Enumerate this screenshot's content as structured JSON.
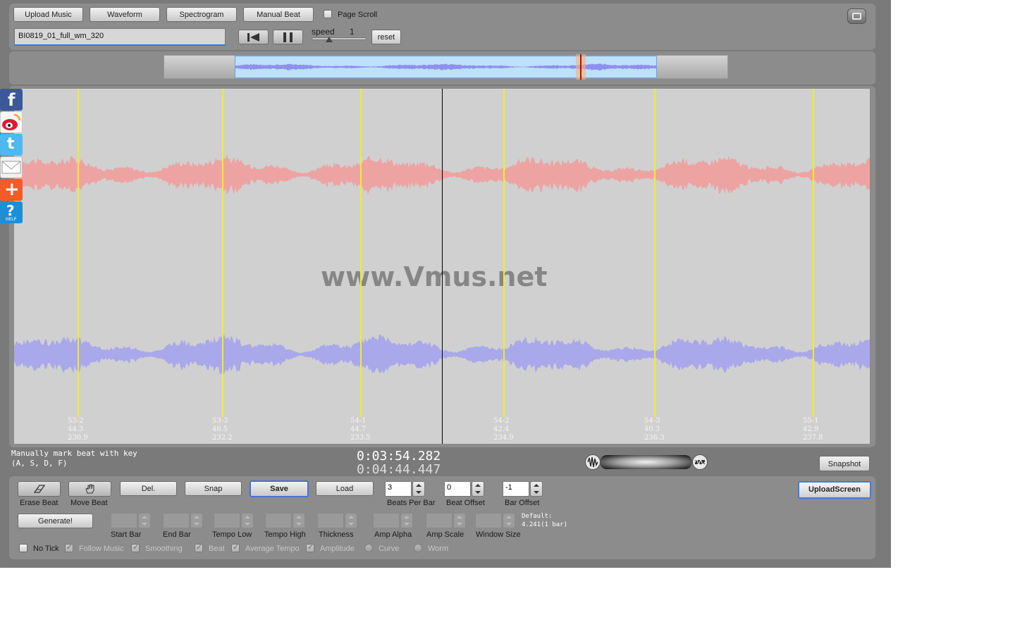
{
  "toolbar": {
    "upload_music": "Upload Music",
    "waveform": "Waveform",
    "spectrogram": "Spectrogram",
    "manual_beat": "Manual Beat",
    "page_scroll": "Page Scroll",
    "file_name": "BI0819_01_full_wm_320",
    "speed_label": "speed",
    "speed_value": "1",
    "reset": "reset"
  },
  "overview": {
    "viewport_start_fraction": 0.125,
    "viewport_end_fraction": 0.875,
    "playhead_fraction": 0.74
  },
  "main_view": {
    "watermark": "www.Vmus.net",
    "beats": [
      {
        "label": "53-2",
        "v1": "44.3",
        "v2": "230.9"
      },
      {
        "label": "53-3",
        "v1": "46.5",
        "v2": "232.2"
      },
      {
        "label": "54-1",
        "v1": "44.7",
        "v2": "233.5"
      },
      {
        "label": "54-2",
        "v1": "42.4",
        "v2": "234.9"
      },
      {
        "label": "54-3",
        "v1": "40.3",
        "v2": "236.3"
      },
      {
        "label": "55-1",
        "v1": "42.9",
        "v2": "237.8"
      }
    ]
  },
  "status": {
    "hint_line1": "Manually mark beat with key",
    "hint_line2": "(A, S, D, F)",
    "current_time": "0:03:54.282",
    "total_time": "0:04:44.447",
    "snapshot": "Snapshot"
  },
  "controls": {
    "erase_beat": "Erase Beat",
    "move_beat": "Move Beat",
    "del": "Del.",
    "snap": "Snap",
    "save": "Save",
    "load": "Load",
    "beats_per_bar_label": "Beats Per Bar",
    "beats_per_bar_value": "3",
    "beat_offset_label": "Beat Offset",
    "beat_offset_value": "0",
    "bar_offset_label": "Bar Offset",
    "bar_offset_value": "-1",
    "upload_screen": "UploadScreen",
    "generate": "Generate!",
    "start_bar": "Start Bar",
    "end_bar": "End Bar",
    "tempo_low": "Tempo Low",
    "tempo_high": "Tempo High",
    "thickness": "Thickness",
    "amp_alpha": "Amp Alpha",
    "amp_scale": "Amp Scale",
    "window_size": "Window Size",
    "default_line1": "Default:",
    "default_line2": "4.241(1 bar)",
    "no_tick": "No Tick",
    "follow_music": "Follow Music",
    "smoothing": "Smoothing",
    "beat": "Beat",
    "average_tempo": "Average Tempo",
    "amplitude": "Amplitude",
    "curve": "Curve",
    "worm": "Worm"
  },
  "colors": {
    "top_wave": "#eea3a3",
    "bottom_wave": "#a9a8ea",
    "beat_line": "#f3ee1d",
    "overview_selection": "#bde0fb"
  }
}
